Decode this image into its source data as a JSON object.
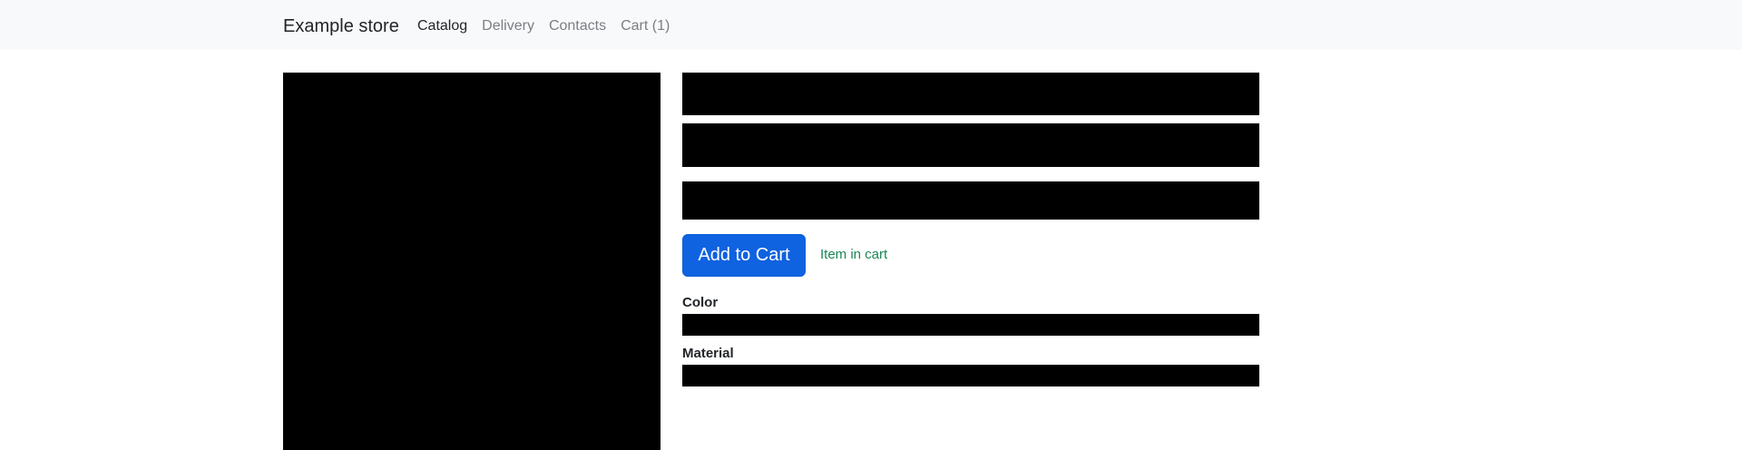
{
  "navbar": {
    "brand": "Example store",
    "links": [
      {
        "label": "Catalog",
        "active": true
      },
      {
        "label": "Delivery",
        "active": false
      },
      {
        "label": "Contacts",
        "active": false
      },
      {
        "label": "Cart (1)",
        "active": false
      }
    ]
  },
  "product": {
    "add_to_cart_label": "Add to Cart",
    "cart_status": "Item in cart",
    "attributes": [
      {
        "label": "Color"
      },
      {
        "label": "Material"
      }
    ]
  },
  "colors": {
    "navbar_bg": "#f8f9fa",
    "primary_button": "#0f62e0",
    "success_text": "#198754",
    "redaction": "#000000"
  }
}
